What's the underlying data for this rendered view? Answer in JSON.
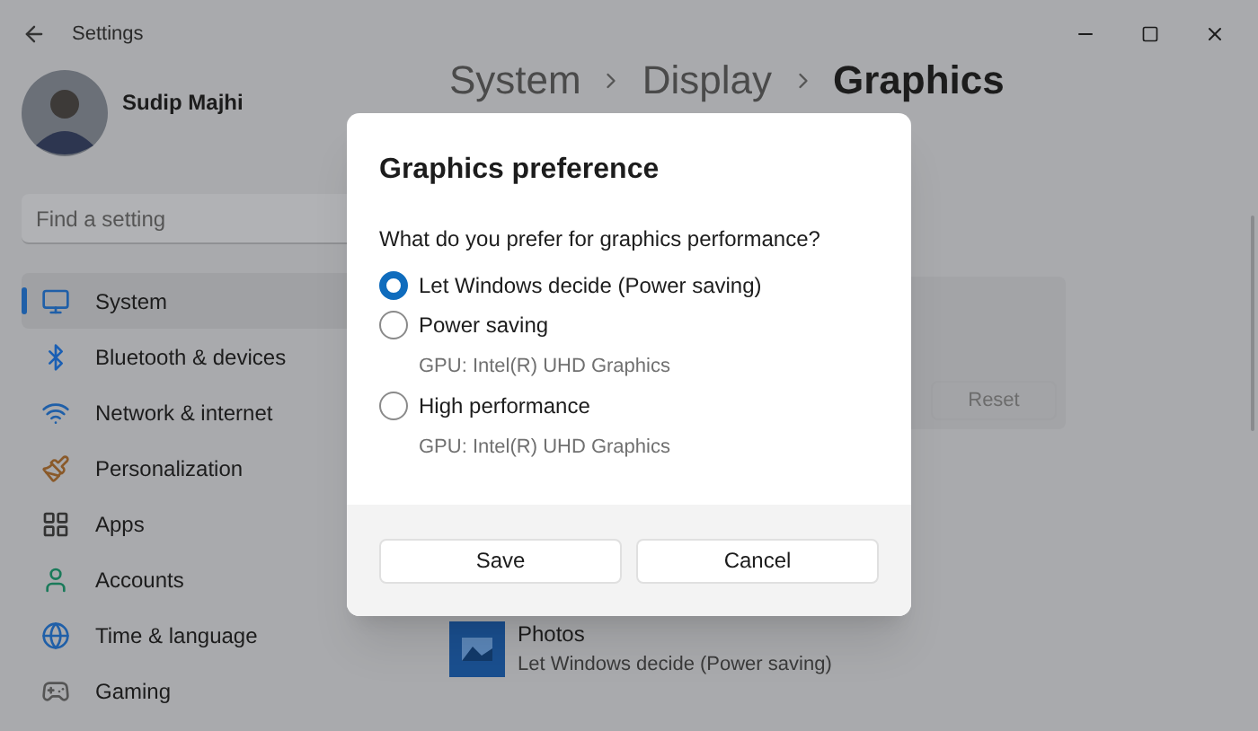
{
  "window": {
    "title": "Settings"
  },
  "user": {
    "name": "Sudip Majhi"
  },
  "search": {
    "placeholder": "Find a setting"
  },
  "nav": [
    {
      "label": "System",
      "selected": true
    },
    {
      "label": "Bluetooth & devices",
      "selected": false
    },
    {
      "label": "Network & internet",
      "selected": false
    },
    {
      "label": "Personalization",
      "selected": false
    },
    {
      "label": "Apps",
      "selected": false
    },
    {
      "label": "Accounts",
      "selected": false
    },
    {
      "label": "Time & language",
      "selected": false
    },
    {
      "label": "Gaming",
      "selected": false
    }
  ],
  "breadcrumb": [
    "System",
    "Display",
    "Graphics"
  ],
  "app_card": {
    "reset_button": "Reset"
  },
  "apps": [
    {
      "name": "Photos",
      "preference": "Let Windows decide (Power saving)"
    }
  ],
  "dialog": {
    "title": "Graphics preference",
    "question": "What do you prefer for graphics performance?",
    "options": [
      {
        "label": "Let Windows decide (Power saving)",
        "selected": true
      },
      {
        "label": "Power saving",
        "detail": "GPU: Intel(R) UHD Graphics",
        "selected": false
      },
      {
        "label": "High performance",
        "detail": "GPU: Intel(R) UHD Graphics",
        "selected": false
      }
    ],
    "buttons": [
      "Save",
      "Cancel"
    ]
  }
}
